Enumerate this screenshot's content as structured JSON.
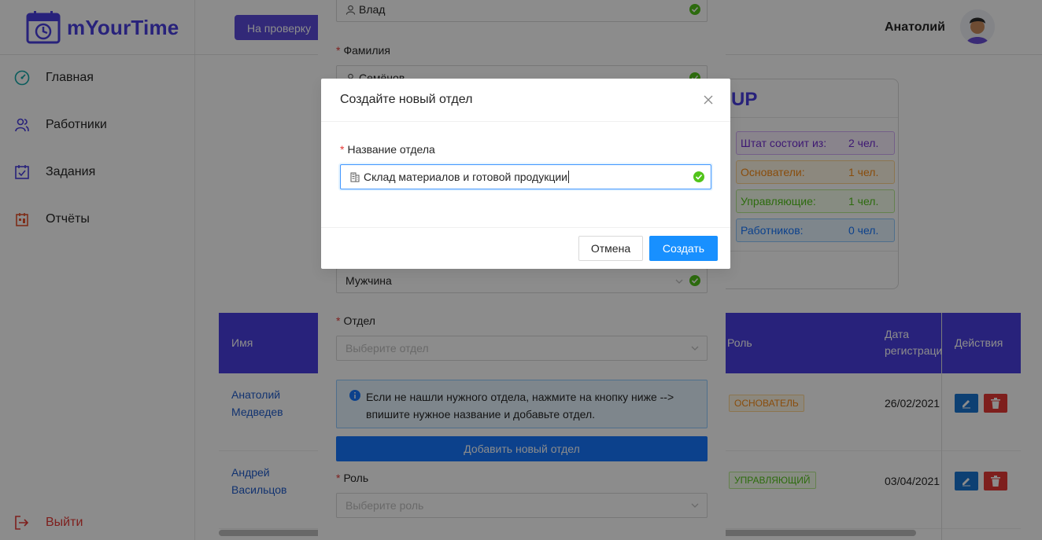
{
  "app": {
    "title": "mYourTime"
  },
  "sidebar": {
    "items": [
      {
        "label": "Главная",
        "icon": "dashboard-icon"
      },
      {
        "label": "Работники",
        "icon": "users-icon"
      },
      {
        "label": "Задания",
        "icon": "calendar-check-icon"
      },
      {
        "label": "Отчёты",
        "icon": "report-icon"
      }
    ],
    "logout_label": "Выйти"
  },
  "header": {
    "review_button": "На проверку",
    "user_name": "Анатолий"
  },
  "group_card": {
    "title_fragment": "UP",
    "stats": [
      {
        "label": "Штат состоит из:",
        "value": "2 чел.",
        "color": "#722ed1"
      },
      {
        "label": "Основатели:",
        "value": "1 чел.",
        "color": "#fa8c16"
      },
      {
        "label": "Управляющие:",
        "value": "1 чел.",
        "color": "#52c41a"
      },
      {
        "label": "Работников:",
        "value": "0 чел.",
        "color": "#1677ff"
      }
    ]
  },
  "table": {
    "headers": {
      "name": "Имя",
      "role": "Роль",
      "date_line1": "Дата",
      "date_line2": "регистрации",
      "actions": "Действия"
    },
    "rows": [
      {
        "first": "Анатолий",
        "last": "Медведев",
        "role": "ОСНОВАТЕЛЬ",
        "role_color": "#fa8c16",
        "date": "26/02/2021"
      },
      {
        "first": "Андрей",
        "last": "Васильцов",
        "role": "УПРАВЛЯЮЩИЙ",
        "role_color": "#52c41a",
        "date": "03/04/2021"
      }
    ]
  },
  "form": {
    "first_name_value": "Влад",
    "last_name_label": "Фамилия",
    "last_name_value": "Семёнов",
    "gender_value": "Мужчина",
    "department_label": "Отдел",
    "department_placeholder": "Выберите отдел",
    "info_text": "Если не нашли нужного отдела, нажмите на кнопку ниже --> впишите нужное название и добавьте отдел.",
    "add_department_button": "Добавить новый отдел",
    "role_label": "Роль",
    "role_placeholder": "Выберите роль"
  },
  "modal": {
    "title": "Создайте новый отдел",
    "field_label": "Название отдела",
    "field_value": "Склад материалов и готовой продукции",
    "cancel_button": "Отмена",
    "create_button": "Создать"
  }
}
